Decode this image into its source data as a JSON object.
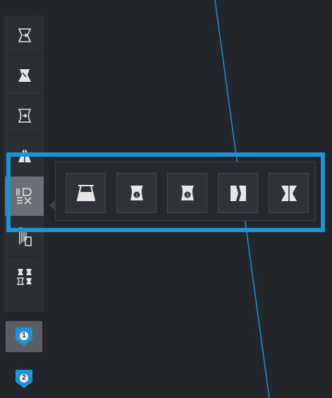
{
  "colors": {
    "background": "#22262b",
    "toolbar": "#2b2f34",
    "accent_blue": "#1f93d3",
    "icon_light": "#e6e6e6",
    "active_tool": "#6b6f75"
  },
  "toolbar": {
    "tools": [
      {
        "name": "taper-arrow-tool",
        "icon": "trapezoid-arrow-icon"
      },
      {
        "name": "taper-fill-tool",
        "icon": "trapezoid-fill-icon"
      },
      {
        "name": "taper-curve-tool",
        "icon": "curved-trapezoid-icon"
      },
      {
        "name": "trapezoid-tool",
        "icon": "trapezoid-icon"
      },
      {
        "name": "shape-grid-tool",
        "icon": "shape-grid-icon",
        "active": true
      },
      {
        "name": "column-profile-tool",
        "icon": "column-profile-icon"
      },
      {
        "name": "double-taper-tool",
        "icon": "double-taper-icon"
      }
    ]
  },
  "flyout": {
    "buttons": [
      {
        "name": "trapezoid-shape-option",
        "icon": "trapezoid-shape-icon"
      },
      {
        "name": "curved-trapezoid-1-option",
        "icon": "curved-trapezoid-1-icon",
        "badge": "1"
      },
      {
        "name": "curved-trapezoid-3-option",
        "icon": "curved-trapezoid-3-icon",
        "badge": "3"
      },
      {
        "name": "notched-rectangle-option",
        "icon": "notched-rectangle-icon"
      },
      {
        "name": "hourglass-rectangle-option",
        "icon": "hourglass-rectangle-icon"
      }
    ]
  },
  "badges": [
    {
      "label": "1",
      "active": true
    },
    {
      "label": "2",
      "active": false
    }
  ]
}
